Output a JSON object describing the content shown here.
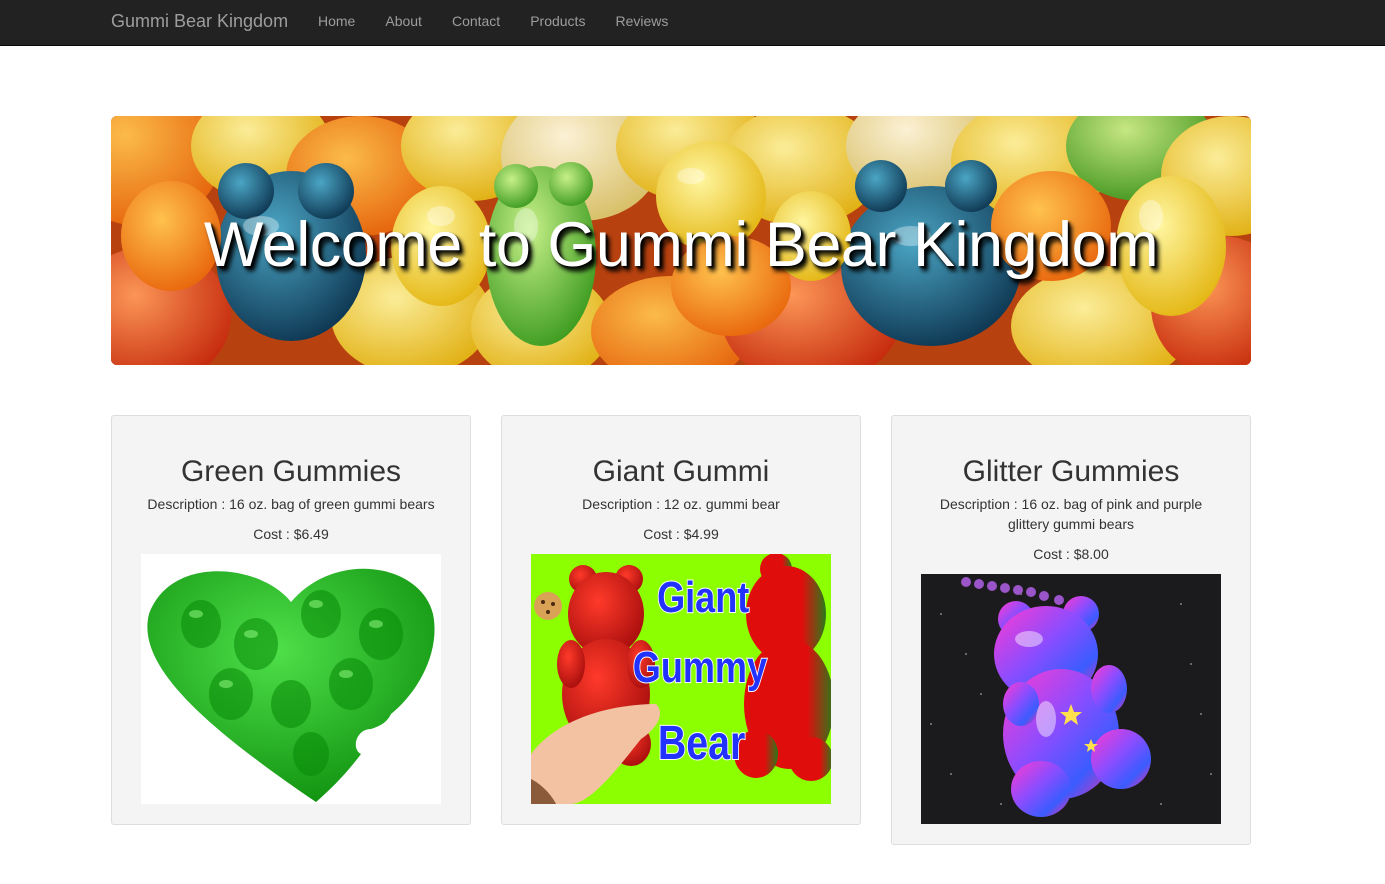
{
  "navbar": {
    "brand": "Gummi Bear Kingdom",
    "links": [
      "Home",
      "About",
      "Contact",
      "Products",
      "Reviews"
    ]
  },
  "hero": {
    "title": "Welcome to Gummi Bear Kingdom"
  },
  "products": [
    {
      "name": "Green Gummies",
      "description": "Description : 16 oz. bag of green gummi bears",
      "cost": "Cost : $6.49",
      "image": "green-heart-gummies"
    },
    {
      "name": "Giant Gummi",
      "description": "Description : 12 oz. gummi bear",
      "cost": "Cost : $4.99",
      "image": "giant-gummy-bear",
      "image_text": [
        "Giant",
        "Gummy",
        "Bear"
      ]
    },
    {
      "name": "Glitter Gummies",
      "description": "Description : 16 oz. bag of pink and purple glittery gummi bears",
      "cost": "Cost : $8.00",
      "image": "glitter-gummy-bear"
    }
  ],
  "colors": {
    "navbar_bg": "#222222",
    "nav_text": "#9d9d9d",
    "card_bg": "#f4f4f4"
  }
}
